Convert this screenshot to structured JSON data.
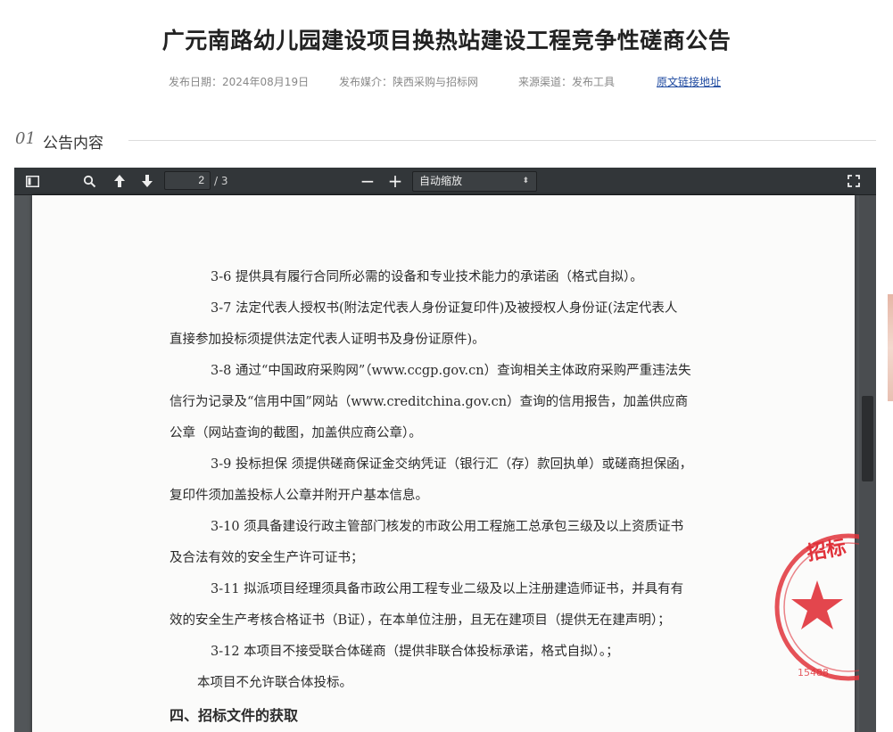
{
  "header": {
    "title": "广元南路幼儿园建设项目换热站建设工程竞争性磋商公告",
    "publish_date": "发布日期：2024年08月19日",
    "publish_media": "发布媒介：陕西采购与招标网",
    "source_channel": "来源渠道：发布工具",
    "original_link": "原文链接地址"
  },
  "section": {
    "number": "01",
    "title": "公告内容"
  },
  "viewer": {
    "toolbar": {
      "sidebar_toggle_icon": "sidebar-icon",
      "search_icon": "search-icon",
      "prev_page_icon": "arrow-up-icon",
      "next_page_icon": "arrow-down-icon",
      "current_page": "2",
      "page_count": "/ 3",
      "zoom_out_label": "−",
      "zoom_in_label": "+",
      "zoom_value": "自动缩放",
      "fullscreen_icon": "fullscreen-icon"
    },
    "page_lines": [
      "3-6 提供具有履行合同所必需的设备和专业技术能力的承诺函（格式自拟）。",
      "3-7 法定代表人授权书(附法定代表人身份证复印件)及被授权人身份证(法定代表人",
      "直接参加投标须提供法定代表人证明书及身份证原件)。",
      "3-8 通过“中国政府采购网”（www.ccgp.gov.cn）查询相关主体政府采购严重违法失",
      "信行为记录及“信用中国”网站（www.creditchina.gov.cn）查询的信用报告，加盖供应商",
      "公章（网站查询的截图，加盖供应商公章）。",
      "3-9 投标担保 须提供磋商保证金交纳凭证（银行汇（存）款回执单）或磋商担保函，",
      "复印件须加盖投标人公章并附开户基本信息。",
      "3-10 须具备建设行政主管部门核发的市政公用工程施工总承包三级及以上资质证书",
      "及合法有效的安全生产许可证书；",
      "3-11 拟派项目经理须具备市政公用工程专业二级及以上注册建造师证书，并具有有",
      "效的安全生产考核合格证书（B证），在本单位注册，且无在建项目（提供无在建声明）；",
      "3-12 本项目不接受联合体磋商（提供非联合体投标承诺，格式自拟）。；",
      "本项目不允许联合体投标。",
      "四、招标文件的获取"
    ],
    "stamp": {
      "text_top": "招标",
      "text_num": "15488",
      "color": "#e0323a"
    }
  }
}
